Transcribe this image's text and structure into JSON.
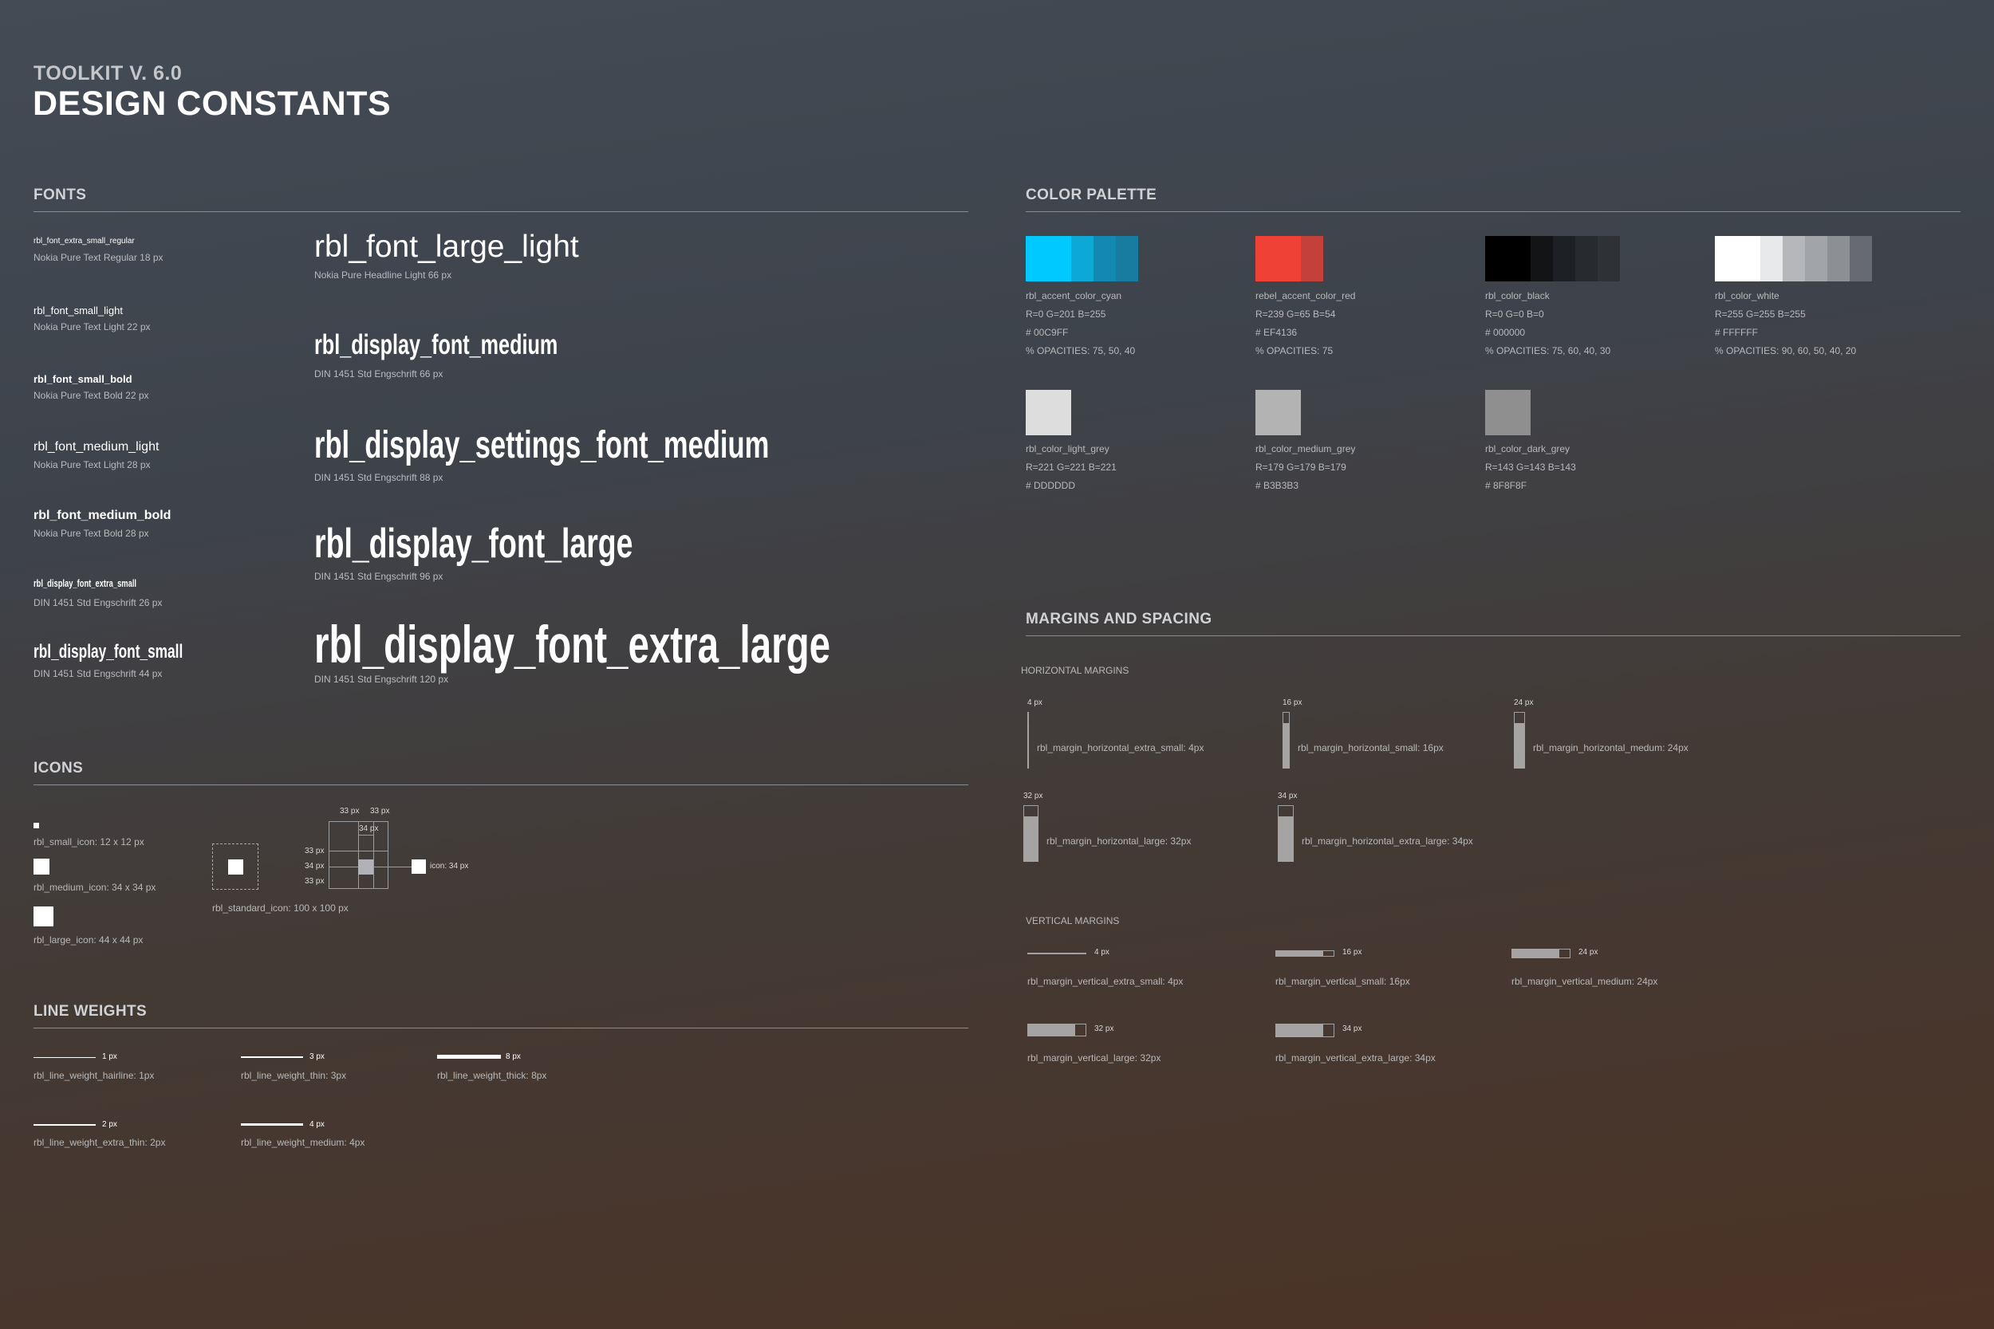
{
  "header": {
    "subtitle": "TOOLKIT V. 6.0",
    "title": "DESIGN CONSTANTS"
  },
  "sections": {
    "fonts": "FONTS",
    "color_palette": "COLOR PALETTE",
    "icons": "ICONS",
    "margins": "MARGINS AND SPACING",
    "line_weights": "LINE WEIGHTS"
  },
  "fonts": {
    "small": [
      {
        "name": "rbl_font_extra_small_regular",
        "desc": "Nokia Pure Text Regular 18 px"
      },
      {
        "name": "rbl_font_small_light",
        "desc": "Nokia Pure Text Light 22 px"
      },
      {
        "name": "rbl_font_small_bold",
        "desc": "Nokia Pure Text Bold 22 px"
      },
      {
        "name": "rbl_font_medium_light",
        "desc": "Nokia Pure Text Light 28 px"
      },
      {
        "name": "rbl_font_medium_bold",
        "desc": "Nokia Pure Text Bold 28 px"
      },
      {
        "name": "rbl_display_font_extra_small",
        "desc": "DIN 1451 Std Engschrift 26 px"
      },
      {
        "name": "rbl_display_font_small",
        "desc": "DIN 1451 Std Engschrift 44 px"
      }
    ],
    "large": [
      {
        "name": "rbl_font_large_light",
        "desc": "Nokia Pure Headline Light 66 px"
      },
      {
        "name": "rbl_display_font_medium",
        "desc": "DIN 1451 Std Engschrift 66 px"
      },
      {
        "name": "rbl_display_settings_font_medium",
        "desc": "DIN 1451 Std Engschrift 88 px"
      },
      {
        "name": "rbl_display_font_large",
        "desc": "DIN 1451 Std Engschrift 96 px"
      },
      {
        "name": "rbl_display_font_extra_large",
        "desc": "DIN 1451 Std Engschrift 120 px"
      }
    ]
  },
  "palette": [
    {
      "name": "rbl_accent_color_cyan",
      "rgb": "R=0 G=201 B=255",
      "hex": "# 00C9FF",
      "opacities": "% OPACITIES: 75, 50, 40",
      "swatches": [
        "#00c9ff",
        "#0ca8d6",
        "#1388b0",
        "#177c9f"
      ]
    },
    {
      "name": "rebel_accent_color_red",
      "rgb": "R=239 G=65 B=54",
      "hex": "# EF4136",
      "opacities": "% OPACITIES: 75",
      "swatches": [
        "#ef4136",
        "#c4403b"
      ]
    },
    {
      "name": "rbl_color_black",
      "rgb": "R=0 G=0 B=0",
      "hex": "# 000000",
      "opacities": "% OPACITIES: 75, 60, 40, 30",
      "swatches": [
        "#000000",
        "#121416",
        "#1d2024",
        "#272b30",
        "#2e3237"
      ]
    },
    {
      "name": "rbl_color_white",
      "rgb": "R=255 G=255 B=255",
      "hex": "# FFFFFF",
      "opacities": "% OPACITIES: 90, 60, 50, 40, 20",
      "swatches": [
        "#ffffff",
        "#e8e9ea",
        "#b5b7ba",
        "#a1a4a8",
        "#8c9095",
        "#676b71"
      ]
    },
    {
      "name": "rbl_color_light_grey",
      "rgb": "R=221 G=221 B=221",
      "hex": "# DDDDDD",
      "swatches": [
        "#dddddd"
      ]
    },
    {
      "name": "rbl_color_medium_grey",
      "rgb": "R=179 G=179 B=179",
      "hex": "# B3B3B3",
      "swatches": [
        "#b3b3b3"
      ]
    },
    {
      "name": "rbl_color_dark_grey",
      "rgb": "R=143 G=143 B=143",
      "hex": "# 8F8F8F",
      "swatches": [
        "#8f8f8f"
      ]
    }
  ],
  "icons": {
    "small": "rbl_small_icon: 12 x 12 px",
    "medium": "rbl_medium_icon: 34 x 34 px",
    "large": "rbl_large_icon: 44 x 44 px",
    "standard": "rbl_standard_icon: 100 x 100 px",
    "dims": {
      "w1": "33 px",
      "w2": "33 px",
      "inner": "34 px",
      "h1": "33 px",
      "h2": "34 px",
      "h3": "33 px",
      "icon": "icon: 34 px"
    }
  },
  "margins": {
    "horizontal_title": "HORIZONTAL MARGINS",
    "vertical_title": "VERTICAL MARGINS",
    "horizontal": [
      {
        "size": "4 px",
        "label": "rbl_margin_horizontal_extra_small: 4px",
        "value": 4
      },
      {
        "size": "16 px",
        "label": "rbl_margin_horizontal_small: 16px",
        "value": 16
      },
      {
        "size": "24 px",
        "label": "rbl_margin_horizontal_medum: 24px",
        "value": 24
      },
      {
        "size": "32 px",
        "label": "rbl_margin_horizontal_large: 32px",
        "value": 32
      },
      {
        "size": "34 px",
        "label": "rbl_margin_horizontal_extra_large: 34px",
        "value": 34
      }
    ],
    "vertical": [
      {
        "size": "4 px",
        "label": "rbl_margin_vertical_extra_small: 4px",
        "value": 4
      },
      {
        "size": "16 px",
        "label": "rbl_margin_vertical_small: 16px",
        "value": 16
      },
      {
        "size": "24 px",
        "label": "rbl_margin_vertical_medium: 24px",
        "value": 24
      },
      {
        "size": "32 px",
        "label": "rbl_margin_vertical_large: 32px",
        "value": 32
      },
      {
        "size": "34 px",
        "label": "rbl_margin_vertical_extra_large: 34px",
        "value": 34
      }
    ]
  },
  "line_weights": [
    {
      "size": "1 px",
      "label": "rbl_line_weight_hairline: 1px",
      "value": 1
    },
    {
      "size": "3 px",
      "label": "rbl_line_weight_thin: 3px",
      "value": 3
    },
    {
      "size": "8 px",
      "label": "rbl_line_weight_thick: 8px",
      "value": 8
    },
    {
      "size": "2 px",
      "label": "rbl_line_weight_extra_thin: 2px",
      "value": 2
    },
    {
      "size": "4 px",
      "label": "rbl_line_weight_medium: 4px",
      "value": 4
    }
  ]
}
